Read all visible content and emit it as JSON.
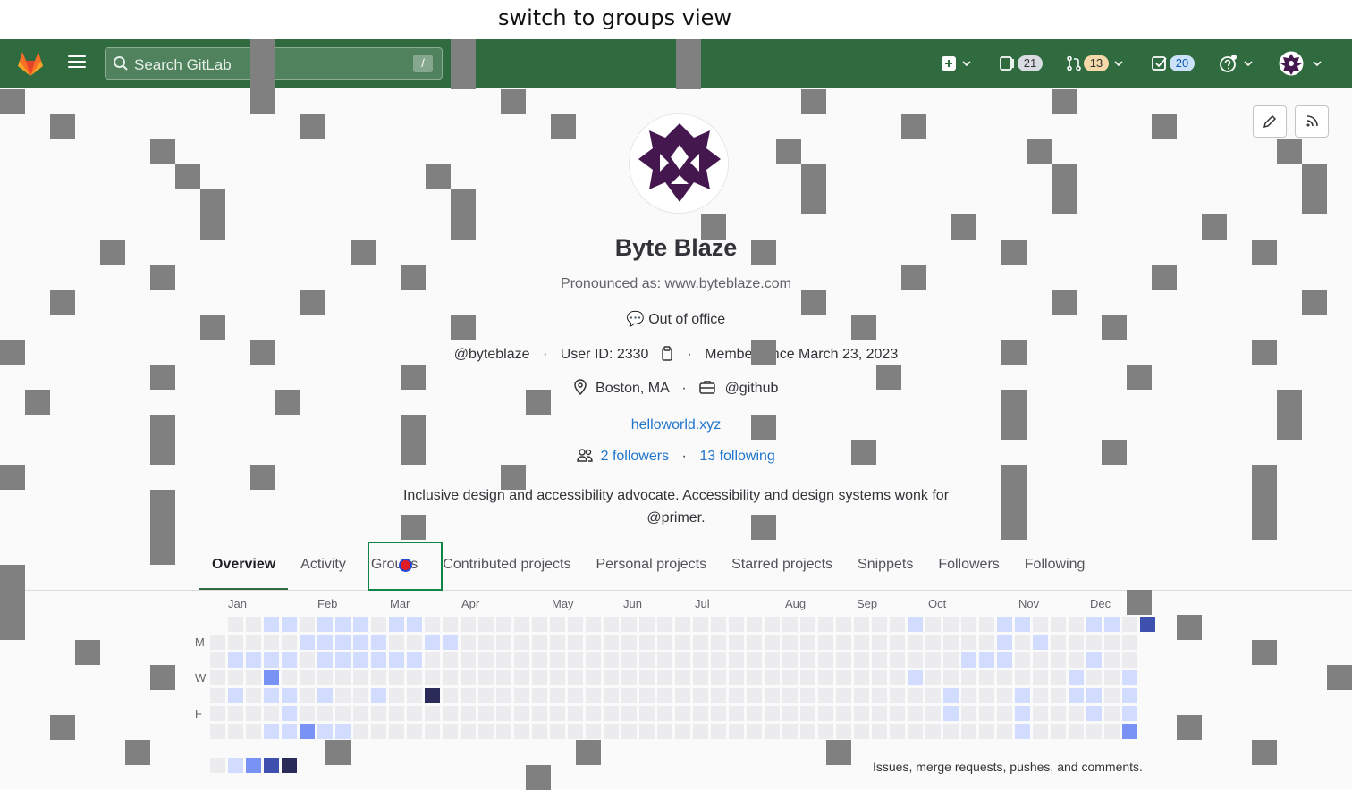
{
  "caption": "switch to groups view",
  "header": {
    "search_placeholder": "Search GitLab",
    "search_shortcut": "/",
    "issues_count": "21",
    "merge_requests_count": "13",
    "todos_count": "20"
  },
  "profile": {
    "name": "Byte Blaze",
    "pronunciation": "Pronounced as: www.byteblaze.com",
    "status": "Out of office",
    "status_emoji": "💬",
    "username": "@byteblaze",
    "user_id": "User ID: 2330",
    "member_since": "Member since March 23, 2023",
    "location": "Boston, MA",
    "organization": "@github",
    "website": "helloworld.xyz",
    "followers": "2 followers",
    "following": "13 following",
    "bio_line1": "Inclusive design and accessibility advocate. Accessibility and design systems wonk for",
    "bio_line2": "@primer."
  },
  "tabs": [
    "Overview",
    "Activity",
    "Groups",
    "Contributed projects",
    "Personal projects",
    "Starred projects",
    "Snippets",
    "Followers",
    "Following"
  ],
  "calendar": {
    "months": [
      "Jan",
      "Feb",
      "Mar",
      "Apr",
      "May",
      "Jun",
      "Jul",
      "Aug",
      "Sep",
      "Oct",
      "Nov",
      "Dec"
    ],
    "day_labels": [
      "M",
      "W",
      "F"
    ],
    "legend_text": "Issues, merge requests, pushes, and comments.",
    "colors": [
      "#ececef",
      "#d2dcff",
      "#7992f5",
      "#3f51ae",
      "#2a2b59"
    ]
  },
  "colors": {
    "topbar": "#2f6b3f",
    "link": "#1f75cb",
    "active_tab_border": "#2f6b3f",
    "highlight": "#108548"
  }
}
